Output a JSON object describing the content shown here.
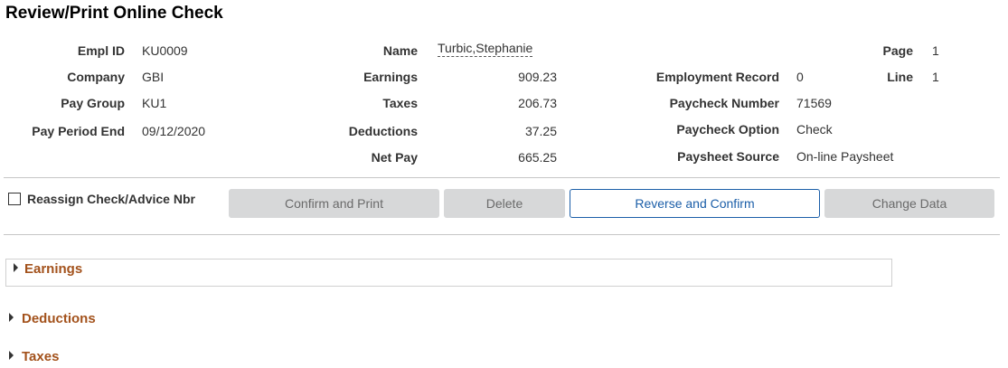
{
  "page_title": "Review/Print Online Check",
  "col1": {
    "empl_id_label": "Empl ID",
    "empl_id": "KU0009",
    "company_label": "Company",
    "company": "GBI",
    "pay_group_label": "Pay Group",
    "pay_group": "KU1",
    "pay_period_end_label": "Pay Period End",
    "pay_period_end": "09/12/2020"
  },
  "col2": {
    "name_label": "Name",
    "name": "Turbic,Stephanie",
    "earnings_label": "Earnings",
    "earnings": "909.23",
    "taxes_label": "Taxes",
    "taxes": "206.73",
    "deductions_label": "Deductions",
    "deductions": "37.25",
    "net_pay_label": "Net Pay",
    "net_pay": "665.25"
  },
  "col3": {
    "employment_record_label": "Employment Record",
    "employment_record": "0",
    "paycheck_number_label": "Paycheck Number",
    "paycheck_number": "71569",
    "paycheck_option_label": "Paycheck Option",
    "paycheck_option": "Check",
    "paysheet_source_label": "Paysheet Source",
    "paysheet_source": "On-line Paysheet"
  },
  "col4": {
    "page_label": "Page",
    "page": "1",
    "line_label": "Line",
    "line": "1"
  },
  "actions": {
    "reassign_label": "Reassign Check/Advice Nbr",
    "reassign_checked": false,
    "confirm_print": "Confirm and Print",
    "delete": "Delete",
    "reverse_confirm": "Reverse and Confirm",
    "change_data": "Change Data"
  },
  "sections": {
    "earnings": "Earnings",
    "deductions": "Deductions",
    "taxes": "Taxes"
  },
  "colors": {
    "section_title": "#a3521c",
    "active_button": "#1b5ea8",
    "disabled_button_bg": "#d7d8d9"
  }
}
